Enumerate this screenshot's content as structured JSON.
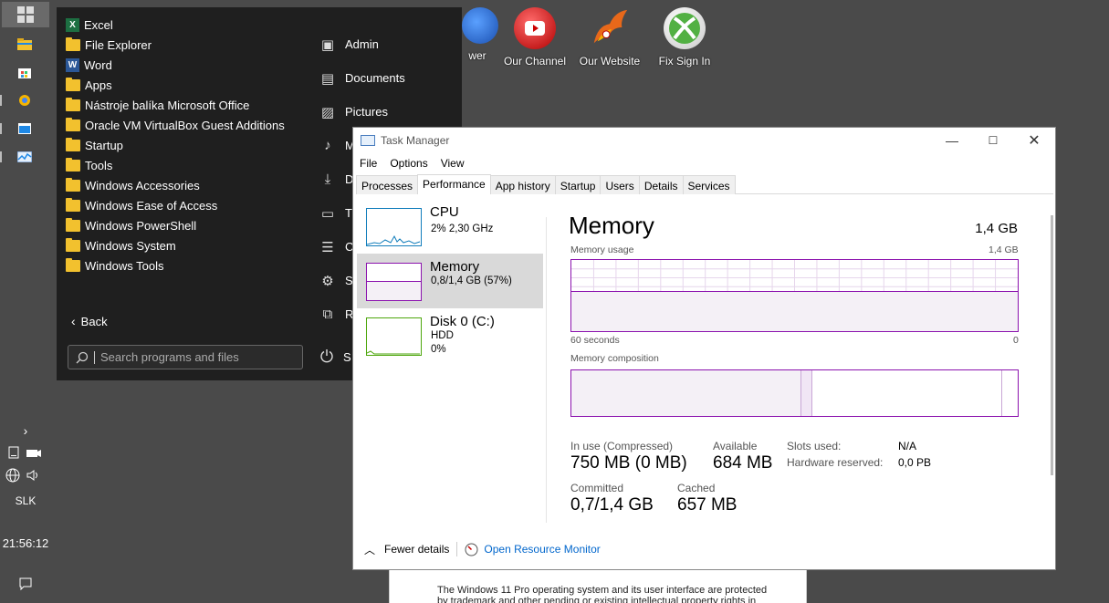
{
  "desktop": {
    "icons": [
      {
        "label": "wer"
      },
      {
        "label": "Our Channel"
      },
      {
        "label": "Our Website"
      },
      {
        "label": "Fix Sign In"
      }
    ]
  },
  "taskbar": {
    "language": "SLK",
    "clock": "21:56:12"
  },
  "start_menu": {
    "programs": [
      {
        "label": "Excel",
        "icon": "excel-icon"
      },
      {
        "label": "File Explorer",
        "icon": "folder-icon"
      },
      {
        "label": "Word",
        "icon": "word-icon"
      },
      {
        "label": "Apps",
        "icon": "folder-icon"
      },
      {
        "label": "Nástroje balíka Microsoft Office",
        "icon": "folder-icon"
      },
      {
        "label": "Oracle VM VirtualBox Guest Additions",
        "icon": "folder-icon"
      },
      {
        "label": "Startup",
        "icon": "folder-icon"
      },
      {
        "label": "Tools",
        "icon": "folder-icon"
      },
      {
        "label": "Windows Accessories",
        "icon": "folder-icon"
      },
      {
        "label": "Windows Ease of Access",
        "icon": "folder-icon"
      },
      {
        "label": "Windows PowerShell",
        "icon": "folder-icon"
      },
      {
        "label": "Windows System",
        "icon": "folder-icon"
      },
      {
        "label": "Windows Tools",
        "icon": "folder-icon"
      }
    ],
    "places": [
      {
        "label": "Admin",
        "icon": "user-icon"
      },
      {
        "label": "Documents",
        "icon": "document-icon"
      },
      {
        "label": "Pictures",
        "icon": "picture-icon"
      },
      {
        "label": "M",
        "icon": "music-icon"
      },
      {
        "label": "D",
        "icon": "download-icon"
      },
      {
        "label": "T",
        "icon": "computer-icon"
      },
      {
        "label": "C",
        "icon": "control-panel-icon"
      },
      {
        "label": "S",
        "icon": "settings-icon"
      },
      {
        "label": "R",
        "icon": "run-icon"
      }
    ],
    "back_label": "Back",
    "search_placeholder": "Search programs and files",
    "power_label": "S"
  },
  "task_manager": {
    "title": "Task Manager",
    "menu": [
      "File",
      "Options",
      "View"
    ],
    "tabs": [
      "Processes",
      "Performance",
      "App history",
      "Startup",
      "Users",
      "Details",
      "Services"
    ],
    "active_tab": "Performance",
    "sidebar": [
      {
        "name": "CPU",
        "line1": "2%  2,30 GHz",
        "line2": "",
        "color": "#117dbb"
      },
      {
        "name": "Memory",
        "line1": "0,8/1,4 GB (57%)",
        "line2": "",
        "color": "#8b12ae"
      },
      {
        "name": "Disk 0 (C:)",
        "line1": "HDD",
        "line2": "0%",
        "color": "#4da60c"
      }
    ],
    "memory": {
      "title": "Memory",
      "total": "1,4 GB",
      "usage_label": "Memory usage",
      "usage_max": "1,4 GB",
      "time_left": "60 seconds",
      "time_right": "0",
      "usage_fraction": 0.57,
      "composition_label": "Memory composition",
      "in_use_label": "In use (Compressed)",
      "in_use_value": "750 MB (0 MB)",
      "available_label": "Available",
      "available_value": "684 MB",
      "committed_label": "Committed",
      "committed_value": "0,7/1,4 GB",
      "cached_label": "Cached",
      "cached_value": "657 MB",
      "slots_label": "Slots used:",
      "slots_value": "N/A",
      "hw_reserved_label": "Hardware reserved:",
      "hw_reserved_value": "0,0 PB"
    },
    "footer": {
      "fewer_details": "Fewer details",
      "resource_monitor": "Open Resource Monitor"
    },
    "accent": "#8b12ae"
  },
  "info_window": {
    "line1": "The Windows 11 Pro operating system and its user interface are protected",
    "line2": "by trademark and other pending or existing intellectual property rights in"
  }
}
